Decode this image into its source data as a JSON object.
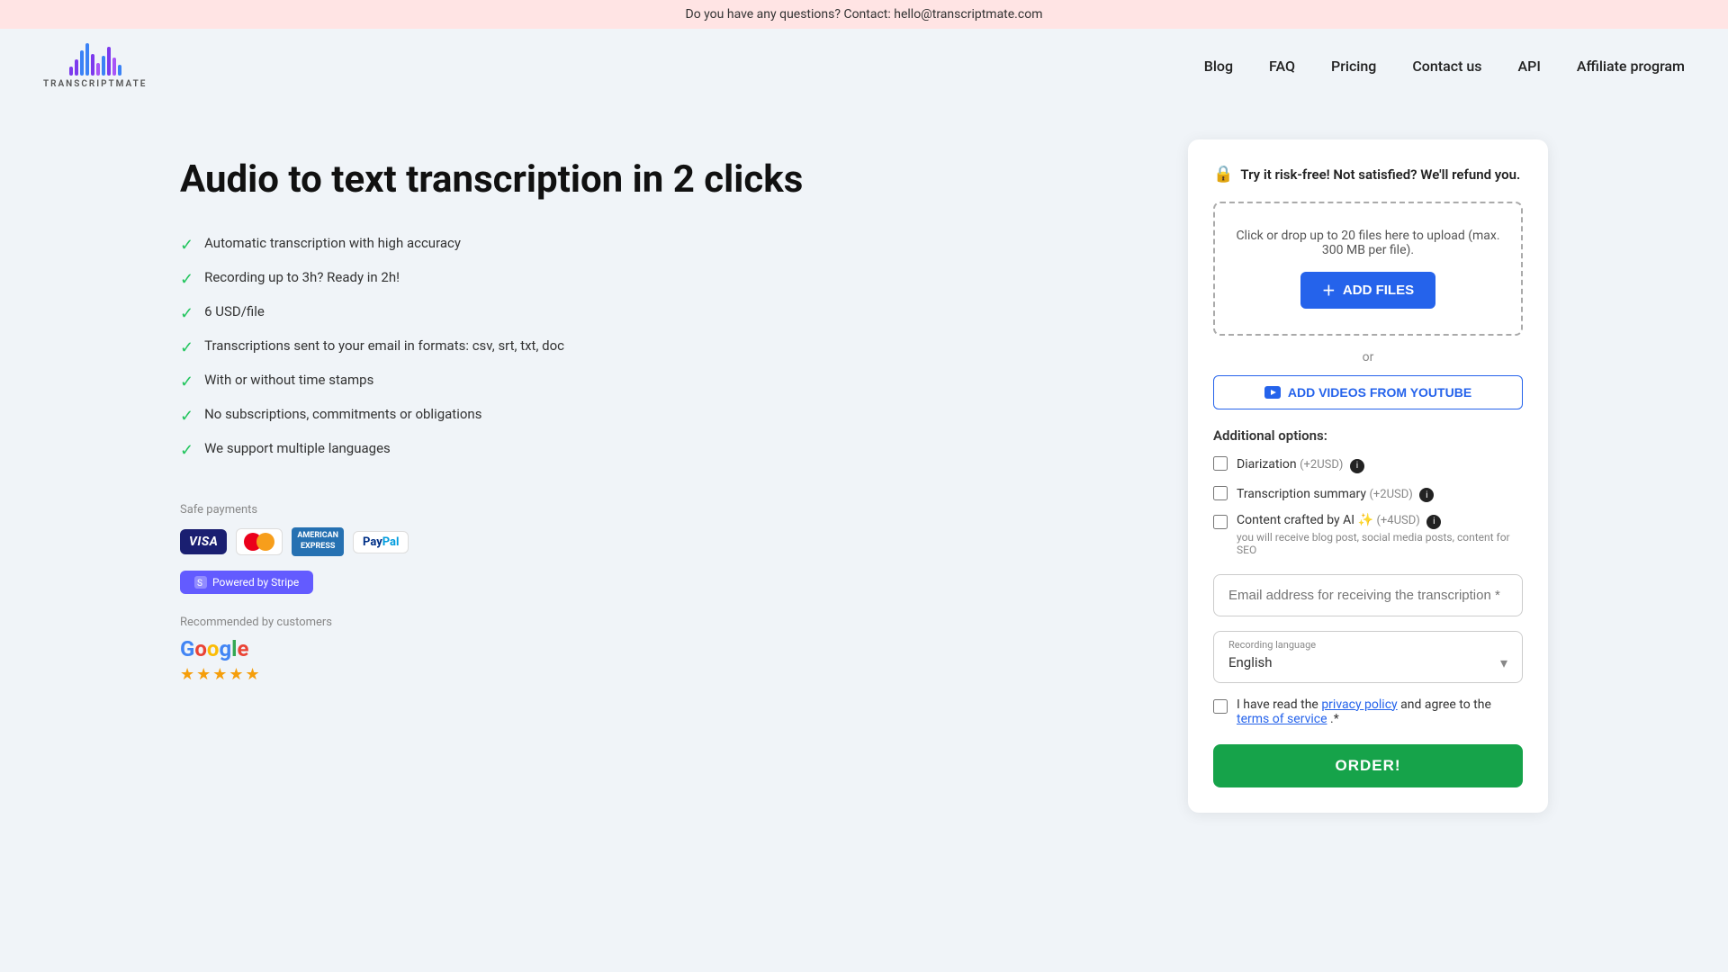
{
  "banner": {
    "text": "Do you have any questions? Contact: hello@transcriptmate.com"
  },
  "nav": {
    "logo_text": "TRANSCRIPTMATE",
    "links": [
      {
        "id": "blog",
        "label": "Blog"
      },
      {
        "id": "faq",
        "label": "FAQ"
      },
      {
        "id": "pricing",
        "label": "Pricing"
      },
      {
        "id": "contact",
        "label": "Contact us"
      },
      {
        "id": "api",
        "label": "API"
      },
      {
        "id": "affiliate",
        "label": "Affiliate program"
      }
    ]
  },
  "hero": {
    "title": "Audio to text transcription in 2 clicks",
    "features": [
      "Automatic transcription with high accuracy",
      "Recording up to 3h? Ready in 2h!",
      "6 USD/file",
      "Transcriptions sent to your email in formats: csv, srt, txt, doc",
      "With or without time stamps",
      "No subscriptions, commitments or obligations",
      "We support multiple languages"
    ],
    "safe_payments_label": "Safe payments",
    "visa_label": "VISA",
    "amex_line1": "AMERICAN",
    "amex_line2": "EXPRESS",
    "paypal_label": "PayPal",
    "stripe_label": "Powered by Stripe",
    "recommended_label": "Recommended by customers",
    "google_label": "Google"
  },
  "form": {
    "risk_free_text": "Try it risk-free! Not satisfied? We'll refund you.",
    "upload_hint": "Click or drop up to 20 files here to upload (max. 300 MB per file).",
    "add_files_label": "ADD FILES",
    "or_label": "or",
    "youtube_btn_label": "ADD VIDEOS FROM YOUTUBE",
    "additional_options_label": "Additional options:",
    "options": [
      {
        "id": "diarization",
        "label": "Diarization",
        "price": "(+2USD)",
        "has_info": true,
        "sub_label": ""
      },
      {
        "id": "transcription_summary",
        "label": "Transcription summary",
        "price": "(+2USD)",
        "has_info": true,
        "sub_label": ""
      },
      {
        "id": "ai_content",
        "label": "Content crafted by AI ✨",
        "price": "(+4USD)",
        "has_info": true,
        "sub_label": "you will receive blog post, social media posts, content for SEO"
      }
    ],
    "email_placeholder": "Email address for receiving the transcription *",
    "language_label": "Recording language",
    "language_value": "English",
    "terms_text1": "I have read the ",
    "privacy_link": "privacy policy",
    "terms_text2": " and agree to the ",
    "tos_link": "terms of service",
    "terms_text3": ".*",
    "order_btn_label": "ORDER!"
  }
}
